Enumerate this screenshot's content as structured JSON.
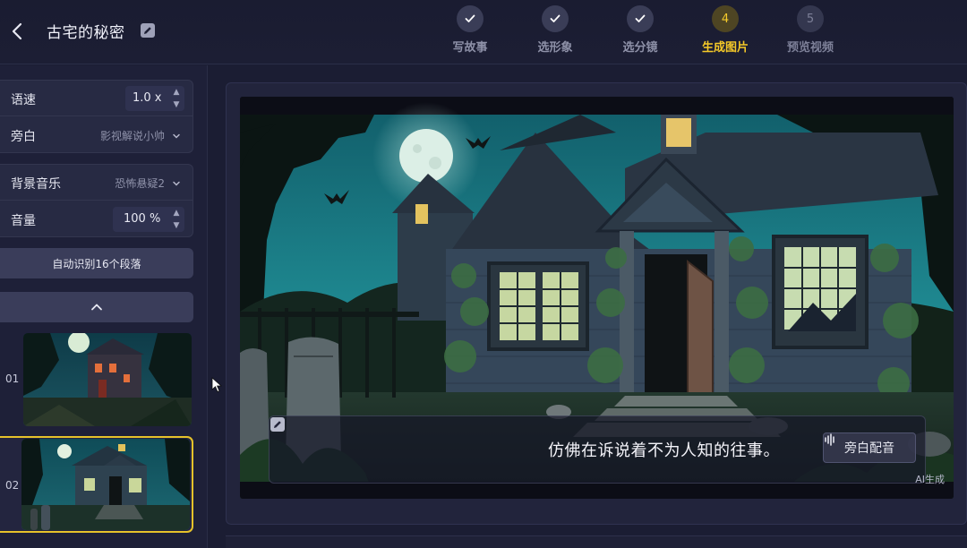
{
  "header": {
    "title": "古宅的秘密",
    "steps": [
      {
        "label": "写故事",
        "state": "done"
      },
      {
        "label": "选形象",
        "state": "done"
      },
      {
        "label": "选分镜",
        "state": "done"
      },
      {
        "label": "生成图片",
        "number": "4",
        "state": "active"
      },
      {
        "label": "预览视频",
        "number": "5",
        "state": "pending"
      }
    ]
  },
  "sidebar": {
    "speed": {
      "label": "语速",
      "value": "1.0 x"
    },
    "narration": {
      "label": "旁白",
      "value": "影视解说小帅"
    },
    "bgm": {
      "label": "背景音乐",
      "value": "恐怖悬疑2"
    },
    "volume": {
      "label": "音量",
      "value": "100 %"
    },
    "auto_button": "自动识别16个段落",
    "scenes": [
      {
        "index": "01",
        "selected": false
      },
      {
        "index": "02",
        "selected": true
      }
    ]
  },
  "preview": {
    "subtitle": "仿佛在诉说着不为人知的往事。",
    "voice_button": "旁白配音",
    "ai_tag": "AI生成"
  },
  "colors": {
    "accent": "#f5c928",
    "background": "#1b1d33",
    "panel": "#272a43"
  }
}
